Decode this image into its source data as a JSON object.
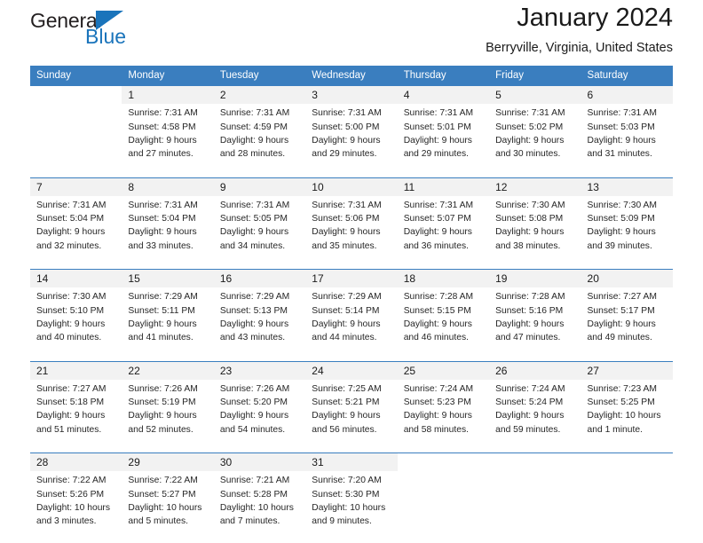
{
  "brand": {
    "name_top": "General",
    "name_bottom": "Blue",
    "accent_color": "#1a74bb"
  },
  "header": {
    "title": "January 2024",
    "subtitle": "Berryville, Virginia, United States"
  },
  "calendar": {
    "header_bg": "#3a7ebf",
    "daynum_bg": "#f2f2f2",
    "weekday_headers": [
      "Sunday",
      "Monday",
      "Tuesday",
      "Wednesday",
      "Thursday",
      "Friday",
      "Saturday"
    ],
    "weeks": [
      [
        {
          "day": "",
          "sunrise": "",
          "sunset": "",
          "daylight1": "",
          "daylight2": ""
        },
        {
          "day": "1",
          "sunrise": "Sunrise: 7:31 AM",
          "sunset": "Sunset: 4:58 PM",
          "daylight1": "Daylight: 9 hours",
          "daylight2": "and 27 minutes."
        },
        {
          "day": "2",
          "sunrise": "Sunrise: 7:31 AM",
          "sunset": "Sunset: 4:59 PM",
          "daylight1": "Daylight: 9 hours",
          "daylight2": "and 28 minutes."
        },
        {
          "day": "3",
          "sunrise": "Sunrise: 7:31 AM",
          "sunset": "Sunset: 5:00 PM",
          "daylight1": "Daylight: 9 hours",
          "daylight2": "and 29 minutes."
        },
        {
          "day": "4",
          "sunrise": "Sunrise: 7:31 AM",
          "sunset": "Sunset: 5:01 PM",
          "daylight1": "Daylight: 9 hours",
          "daylight2": "and 29 minutes."
        },
        {
          "day": "5",
          "sunrise": "Sunrise: 7:31 AM",
          "sunset": "Sunset: 5:02 PM",
          "daylight1": "Daylight: 9 hours",
          "daylight2": "and 30 minutes."
        },
        {
          "day": "6",
          "sunrise": "Sunrise: 7:31 AM",
          "sunset": "Sunset: 5:03 PM",
          "daylight1": "Daylight: 9 hours",
          "daylight2": "and 31 minutes."
        }
      ],
      [
        {
          "day": "7",
          "sunrise": "Sunrise: 7:31 AM",
          "sunset": "Sunset: 5:04 PM",
          "daylight1": "Daylight: 9 hours",
          "daylight2": "and 32 minutes."
        },
        {
          "day": "8",
          "sunrise": "Sunrise: 7:31 AM",
          "sunset": "Sunset: 5:04 PM",
          "daylight1": "Daylight: 9 hours",
          "daylight2": "and 33 minutes."
        },
        {
          "day": "9",
          "sunrise": "Sunrise: 7:31 AM",
          "sunset": "Sunset: 5:05 PM",
          "daylight1": "Daylight: 9 hours",
          "daylight2": "and 34 minutes."
        },
        {
          "day": "10",
          "sunrise": "Sunrise: 7:31 AM",
          "sunset": "Sunset: 5:06 PM",
          "daylight1": "Daylight: 9 hours",
          "daylight2": "and 35 minutes."
        },
        {
          "day": "11",
          "sunrise": "Sunrise: 7:31 AM",
          "sunset": "Sunset: 5:07 PM",
          "daylight1": "Daylight: 9 hours",
          "daylight2": "and 36 minutes."
        },
        {
          "day": "12",
          "sunrise": "Sunrise: 7:30 AM",
          "sunset": "Sunset: 5:08 PM",
          "daylight1": "Daylight: 9 hours",
          "daylight2": "and 38 minutes."
        },
        {
          "day": "13",
          "sunrise": "Sunrise: 7:30 AM",
          "sunset": "Sunset: 5:09 PM",
          "daylight1": "Daylight: 9 hours",
          "daylight2": "and 39 minutes."
        }
      ],
      [
        {
          "day": "14",
          "sunrise": "Sunrise: 7:30 AM",
          "sunset": "Sunset: 5:10 PM",
          "daylight1": "Daylight: 9 hours",
          "daylight2": "and 40 minutes."
        },
        {
          "day": "15",
          "sunrise": "Sunrise: 7:29 AM",
          "sunset": "Sunset: 5:11 PM",
          "daylight1": "Daylight: 9 hours",
          "daylight2": "and 41 minutes."
        },
        {
          "day": "16",
          "sunrise": "Sunrise: 7:29 AM",
          "sunset": "Sunset: 5:13 PM",
          "daylight1": "Daylight: 9 hours",
          "daylight2": "and 43 minutes."
        },
        {
          "day": "17",
          "sunrise": "Sunrise: 7:29 AM",
          "sunset": "Sunset: 5:14 PM",
          "daylight1": "Daylight: 9 hours",
          "daylight2": "and 44 minutes."
        },
        {
          "day": "18",
          "sunrise": "Sunrise: 7:28 AM",
          "sunset": "Sunset: 5:15 PM",
          "daylight1": "Daylight: 9 hours",
          "daylight2": "and 46 minutes."
        },
        {
          "day": "19",
          "sunrise": "Sunrise: 7:28 AM",
          "sunset": "Sunset: 5:16 PM",
          "daylight1": "Daylight: 9 hours",
          "daylight2": "and 47 minutes."
        },
        {
          "day": "20",
          "sunrise": "Sunrise: 7:27 AM",
          "sunset": "Sunset: 5:17 PM",
          "daylight1": "Daylight: 9 hours",
          "daylight2": "and 49 minutes."
        }
      ],
      [
        {
          "day": "21",
          "sunrise": "Sunrise: 7:27 AM",
          "sunset": "Sunset: 5:18 PM",
          "daylight1": "Daylight: 9 hours",
          "daylight2": "and 51 minutes."
        },
        {
          "day": "22",
          "sunrise": "Sunrise: 7:26 AM",
          "sunset": "Sunset: 5:19 PM",
          "daylight1": "Daylight: 9 hours",
          "daylight2": "and 52 minutes."
        },
        {
          "day": "23",
          "sunrise": "Sunrise: 7:26 AM",
          "sunset": "Sunset: 5:20 PM",
          "daylight1": "Daylight: 9 hours",
          "daylight2": "and 54 minutes."
        },
        {
          "day": "24",
          "sunrise": "Sunrise: 7:25 AM",
          "sunset": "Sunset: 5:21 PM",
          "daylight1": "Daylight: 9 hours",
          "daylight2": "and 56 minutes."
        },
        {
          "day": "25",
          "sunrise": "Sunrise: 7:24 AM",
          "sunset": "Sunset: 5:23 PM",
          "daylight1": "Daylight: 9 hours",
          "daylight2": "and 58 minutes."
        },
        {
          "day": "26",
          "sunrise": "Sunrise: 7:24 AM",
          "sunset": "Sunset: 5:24 PM",
          "daylight1": "Daylight: 9 hours",
          "daylight2": "and 59 minutes."
        },
        {
          "day": "27",
          "sunrise": "Sunrise: 7:23 AM",
          "sunset": "Sunset: 5:25 PM",
          "daylight1": "Daylight: 10 hours",
          "daylight2": "and 1 minute."
        }
      ],
      [
        {
          "day": "28",
          "sunrise": "Sunrise: 7:22 AM",
          "sunset": "Sunset: 5:26 PM",
          "daylight1": "Daylight: 10 hours",
          "daylight2": "and 3 minutes."
        },
        {
          "day": "29",
          "sunrise": "Sunrise: 7:22 AM",
          "sunset": "Sunset: 5:27 PM",
          "daylight1": "Daylight: 10 hours",
          "daylight2": "and 5 minutes."
        },
        {
          "day": "30",
          "sunrise": "Sunrise: 7:21 AM",
          "sunset": "Sunset: 5:28 PM",
          "daylight1": "Daylight: 10 hours",
          "daylight2": "and 7 minutes."
        },
        {
          "day": "31",
          "sunrise": "Sunrise: 7:20 AM",
          "sunset": "Sunset: 5:30 PM",
          "daylight1": "Daylight: 10 hours",
          "daylight2": "and 9 minutes."
        },
        {
          "day": "",
          "sunrise": "",
          "sunset": "",
          "daylight1": "",
          "daylight2": ""
        },
        {
          "day": "",
          "sunrise": "",
          "sunset": "",
          "daylight1": "",
          "daylight2": ""
        },
        {
          "day": "",
          "sunrise": "",
          "sunset": "",
          "daylight1": "",
          "daylight2": ""
        }
      ]
    ]
  }
}
